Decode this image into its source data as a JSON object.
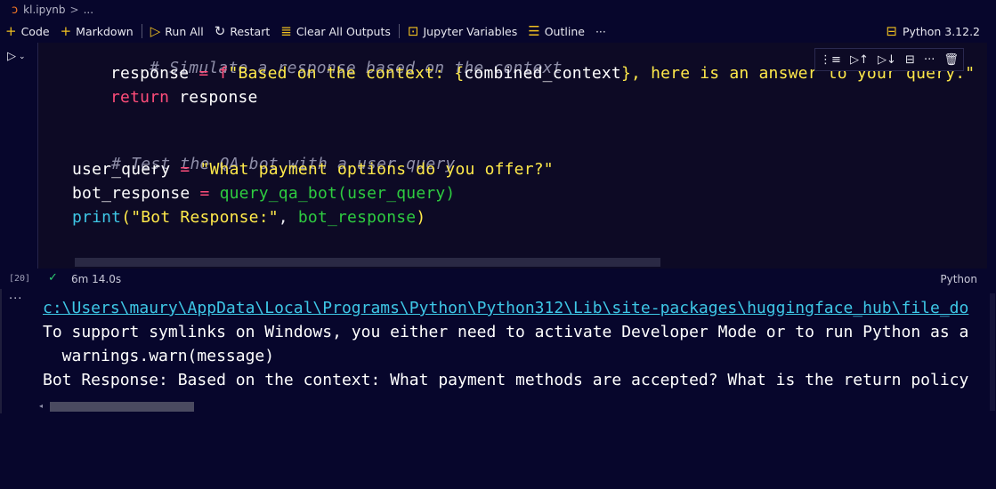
{
  "breadcrumb": {
    "file": "kl.ipynb",
    "sep": ">",
    "more": "..."
  },
  "toolbar": {
    "code": "Code",
    "markdown": "Markdown",
    "run_all": "Run All",
    "restart": "Restart",
    "clear_outputs": "Clear All Outputs",
    "variables": "Jupyter Variables",
    "outline": "Outline",
    "more": "···",
    "kernel": "Python 3.12.2"
  },
  "cell": {
    "execution_count": "[20]",
    "duration": "6m 14.0s",
    "language": "Python",
    "code": {
      "l1_comment": "# Simulate a response based on the context",
      "l2_var": "response",
      "l2_eq": " = ",
      "l2_f": "f",
      "l2_str1": "\"Based on the context: ",
      "l2_brace_open": "{",
      "l2_interp": "combined_context",
      "l2_brace_close": "}",
      "l2_str2": ", here is an answer to your query.\"",
      "l3_kw": "return",
      "l3_var": " response",
      "l5_comment": "# Test the QA bot with a user query",
      "l6_var": "user_query",
      "l6_eq": " = ",
      "l6_str": "\"What payment options do you offer?\"",
      "l7_var": "bot_response",
      "l7_eq": " = ",
      "l7_fn": "query_qa_bot",
      "l7_args": "(user_query)",
      "l8_fn": "print",
      "l8_paren": "(",
      "l8_str": "\"Bot Response:\"",
      "l8_rest": ", ",
      "l8_arg": "bot_response",
      "l8_close": ")"
    }
  },
  "output": {
    "dots": "···",
    "lines": [
      "c:\\Users\\maury\\AppData\\Local\\Programs\\Python\\Python312\\Lib\\site-packages\\huggingface_hub\\file_do",
      "To support symlinks on Windows, you either need to activate Developer Mode or to run Python as a",
      "  warnings.warn(message)",
      "Bot Response: Based on the context: What payment methods are accepted? What is the return policy"
    ]
  }
}
